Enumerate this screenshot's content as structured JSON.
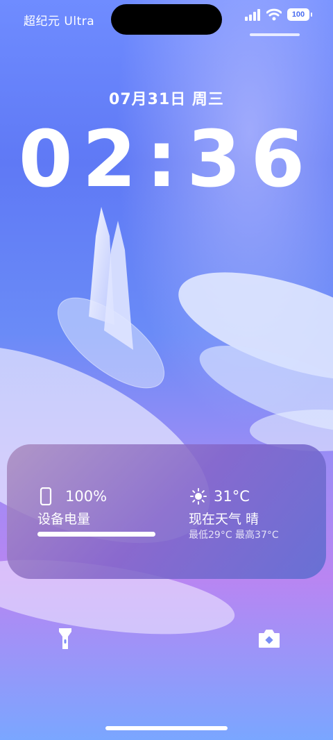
{
  "status_bar": {
    "carrier": "超纪元 Ultra",
    "battery_level": "100",
    "icons": [
      "signal-icon",
      "wifi-icon",
      "battery-icon"
    ]
  },
  "lock_screen": {
    "date": "07月31日 周三",
    "time": "02:36"
  },
  "widget": {
    "battery": {
      "icon": "phone-icon",
      "percent": "100%",
      "label": "设备电量",
      "level": 1.0
    },
    "weather": {
      "icon": "sun-icon",
      "temperature": "31°C",
      "label": "现在天气 晴",
      "range": "最低29°C  最高37°C"
    }
  },
  "controls": {
    "left": "flashlight-icon",
    "right": "camera-icon"
  },
  "colors": {
    "background_top": "#6f8cff",
    "background_mid": "#b985f2",
    "widget_tint": "#8a6cc8",
    "text": "#ffffff"
  }
}
